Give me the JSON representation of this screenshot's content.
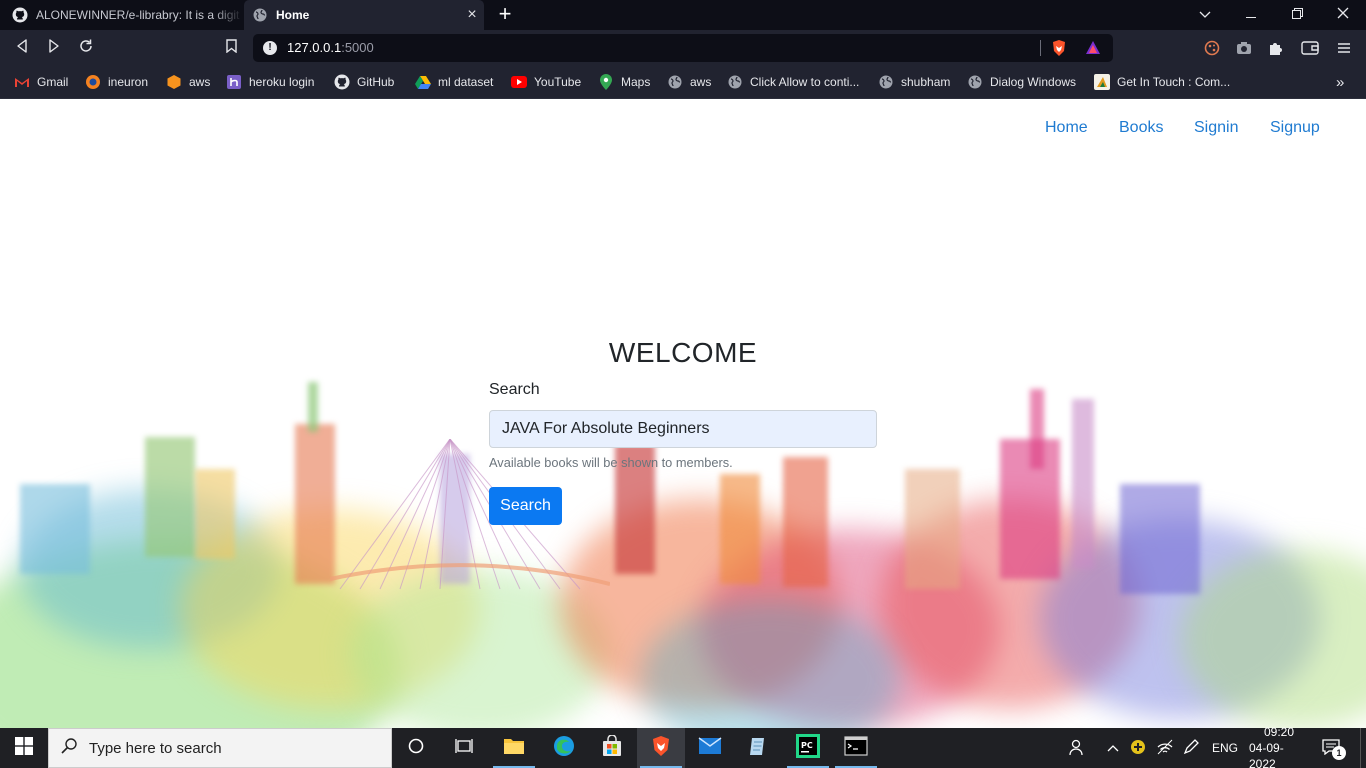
{
  "browser": {
    "tabs": [
      {
        "title": "ALONEWINNER/e-librabry: It is a digit",
        "icon": "github-icon",
        "active": false
      },
      {
        "title": "Home",
        "icon": "globe-icon",
        "active": true
      }
    ],
    "new_tab_label": "+",
    "close_label": "×",
    "url_host": "127.0.0.1",
    "url_port": ":5000",
    "info_label": "!",
    "bookmarks": [
      {
        "label": "Gmail",
        "icon": "gmail-icon"
      },
      {
        "label": "ineuron",
        "icon": "ineuron-icon"
      },
      {
        "label": "aws",
        "icon": "aws-icon"
      },
      {
        "label": "heroku login",
        "icon": "heroku-icon"
      },
      {
        "label": "GitHub",
        "icon": "github-icon"
      },
      {
        "label": "ml dataset",
        "icon": "drive-icon"
      },
      {
        "label": "YouTube",
        "icon": "youtube-icon"
      },
      {
        "label": "Maps",
        "icon": "maps-icon"
      },
      {
        "label": "aws",
        "icon": "globe-icon"
      },
      {
        "label": "Click Allow to conti...",
        "icon": "globe-icon"
      },
      {
        "label": "shubham",
        "icon": "globe-icon"
      },
      {
        "label": "Dialog Windows",
        "icon": "globe-icon"
      },
      {
        "label": "Get In Touch : Com...",
        "icon": "page-icon"
      }
    ],
    "overflow_label": "»"
  },
  "page": {
    "nav": [
      "Home",
      "Books",
      "Signin",
      "Signup"
    ],
    "heading": "WELCOME",
    "search_label": "Search",
    "search_value": "JAVA For Absolute Beginners",
    "help_text": "Available books will be shown to members.",
    "search_button": "Search"
  },
  "taskbar": {
    "search_placeholder": "Type here to search",
    "language": "ENG",
    "time": "09:20",
    "date": "04-09-2022",
    "notification_count": "1"
  },
  "colors": {
    "tab_strip": "#0d0e17",
    "toolbar": "#212330",
    "link": "#1f7bd1",
    "primary_button": "#0b79f2",
    "input_bg": "#e8f0fe",
    "taskbar": "#1f2024"
  }
}
